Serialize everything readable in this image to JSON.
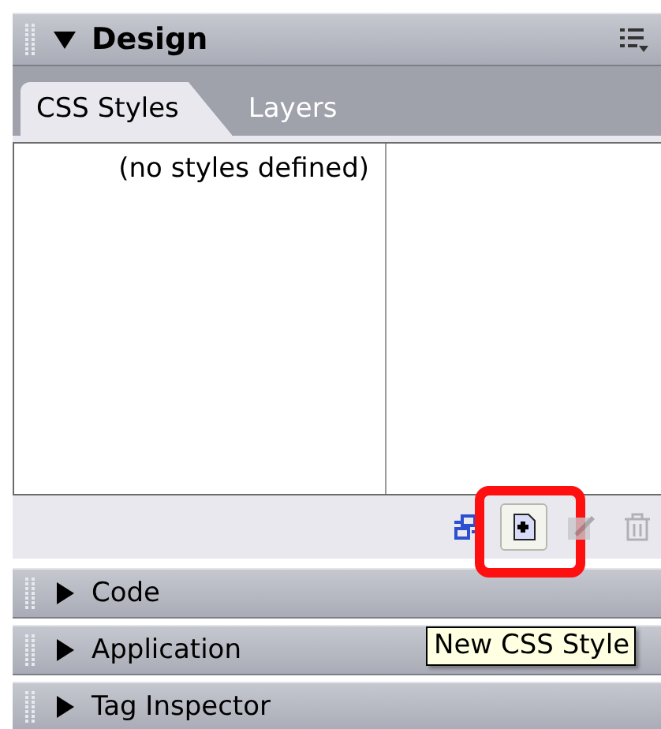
{
  "design_panel": {
    "title": "Design",
    "expanded": true
  },
  "tabs": [
    {
      "label": "CSS Styles",
      "selected": true
    },
    {
      "label": "Layers",
      "selected": false
    }
  ],
  "styles_list": {
    "empty_text": "(no styles defined)"
  },
  "toolbar": [
    {
      "kind": "attach",
      "disabled": false,
      "highlighted": false
    },
    {
      "kind": "new",
      "disabled": false,
      "highlighted": true
    },
    {
      "kind": "edit",
      "disabled": true,
      "highlighted": false
    },
    {
      "kind": "delete",
      "disabled": true,
      "highlighted": false
    }
  ],
  "tooltip": "New CSS Style",
  "collapsed_panels": [
    {
      "title": "Code",
      "expanded": false
    },
    {
      "title": "Application",
      "expanded": false
    },
    {
      "title": "Tag Inspector",
      "expanded": false
    }
  ]
}
